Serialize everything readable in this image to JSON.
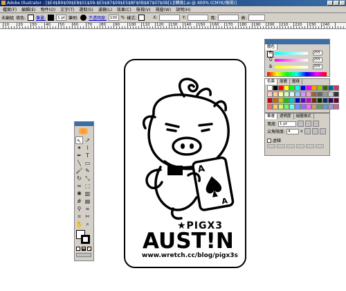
{
  "titlebar": {
    "text": "Adobe Illustrator - [$E4$B9$09$E8$01$09-$E5$87$09$E5$8F$0B$87$07$0B[1][轉換].ai @ 400% (CMYK/預視)]"
  },
  "menubar": {
    "items": [
      "檔案(F)",
      "編輯(E)",
      "物件(O)",
      "文字(T)",
      "選取(S)",
      "濾鏡(L)",
      "效果(C)",
      "檢視(V)",
      "視窗(W)",
      "說明(H)"
    ]
  },
  "controlbar": {
    "label_mode": "未編組",
    "label_fill": "填色:",
    "label_stroke": "筆畫:",
    "stroke_value": "1 pt",
    "label_brush": "筆刷:",
    "label_opacity": "不透明度:",
    "opacity_value": "100",
    "opacity_unit": "%",
    "label_style": "樣式:",
    "label_x": "X:",
    "label_y": "Y:",
    "label_w": "寬:",
    "label_h": "高:"
  },
  "ruler": {
    "labels": [
      "10",
      "20",
      "30",
      "40",
      "50",
      "60",
      "70",
      "80",
      "90",
      "100",
      "110",
      "120",
      "130",
      "140",
      "150",
      "160",
      "170",
      "180",
      "190",
      "200",
      "210",
      "220",
      "230",
      "240"
    ]
  },
  "artwork": {
    "brand_line": "★PIGX3",
    "name": "AUST!N",
    "url": "www.wretch.cc/blog/pigx3s",
    "card_letter_top": "A",
    "card_letter_bottom": "A"
  },
  "color_panel": {
    "tab": "顏色",
    "r_label": "R",
    "g_label": "G",
    "b_label": "B",
    "r_value": "255",
    "g_value": "255",
    "b_value": "255"
  },
  "swatches_panel": {
    "tabs": [
      "色票",
      "漸層",
      "圖樣"
    ],
    "colors": [
      "#ffffff",
      "#000000",
      "#ff0000",
      "#ffff00",
      "#00ff00",
      "#00ffff",
      "#0000ff",
      "#ff00ff",
      "#ff9900",
      "#99cc00",
      "#336600",
      "#006699",
      "#cc3366",
      "#ffcccc",
      "#ffcc99",
      "#ffff99",
      "#ccffcc",
      "#ccffff",
      "#99ccff",
      "#cc99ff",
      "#ff99cc",
      "#996633",
      "#666666",
      "#999999",
      "#cccccc",
      "#333333",
      "#cc0000",
      "#cc6600",
      "#cccc00",
      "#00cc00",
      "#00cccc",
      "#0000cc",
      "#6600cc",
      "#cc00cc",
      "#663300",
      "#003300",
      "#003366",
      "#330066",
      "#660033",
      "#ff6666",
      "#ffcc66",
      "#ccff66",
      "#66ff66",
      "#66ffff",
      "#6699ff",
      "#9966ff",
      "#ff66ff",
      "#cc9966",
      "#669966",
      "#6699cc",
      "#9999cc",
      "#cc6699"
    ]
  },
  "stroke_panel": {
    "tabs": [
      "筆畫",
      "透明度",
      "繪圖樣式"
    ],
    "weight_label": "寬度:",
    "weight_value": "1 pt",
    "miter_label": "尖角限度:",
    "miter_value": "4",
    "miter_unit": "x",
    "dashed_label": "虛線"
  }
}
